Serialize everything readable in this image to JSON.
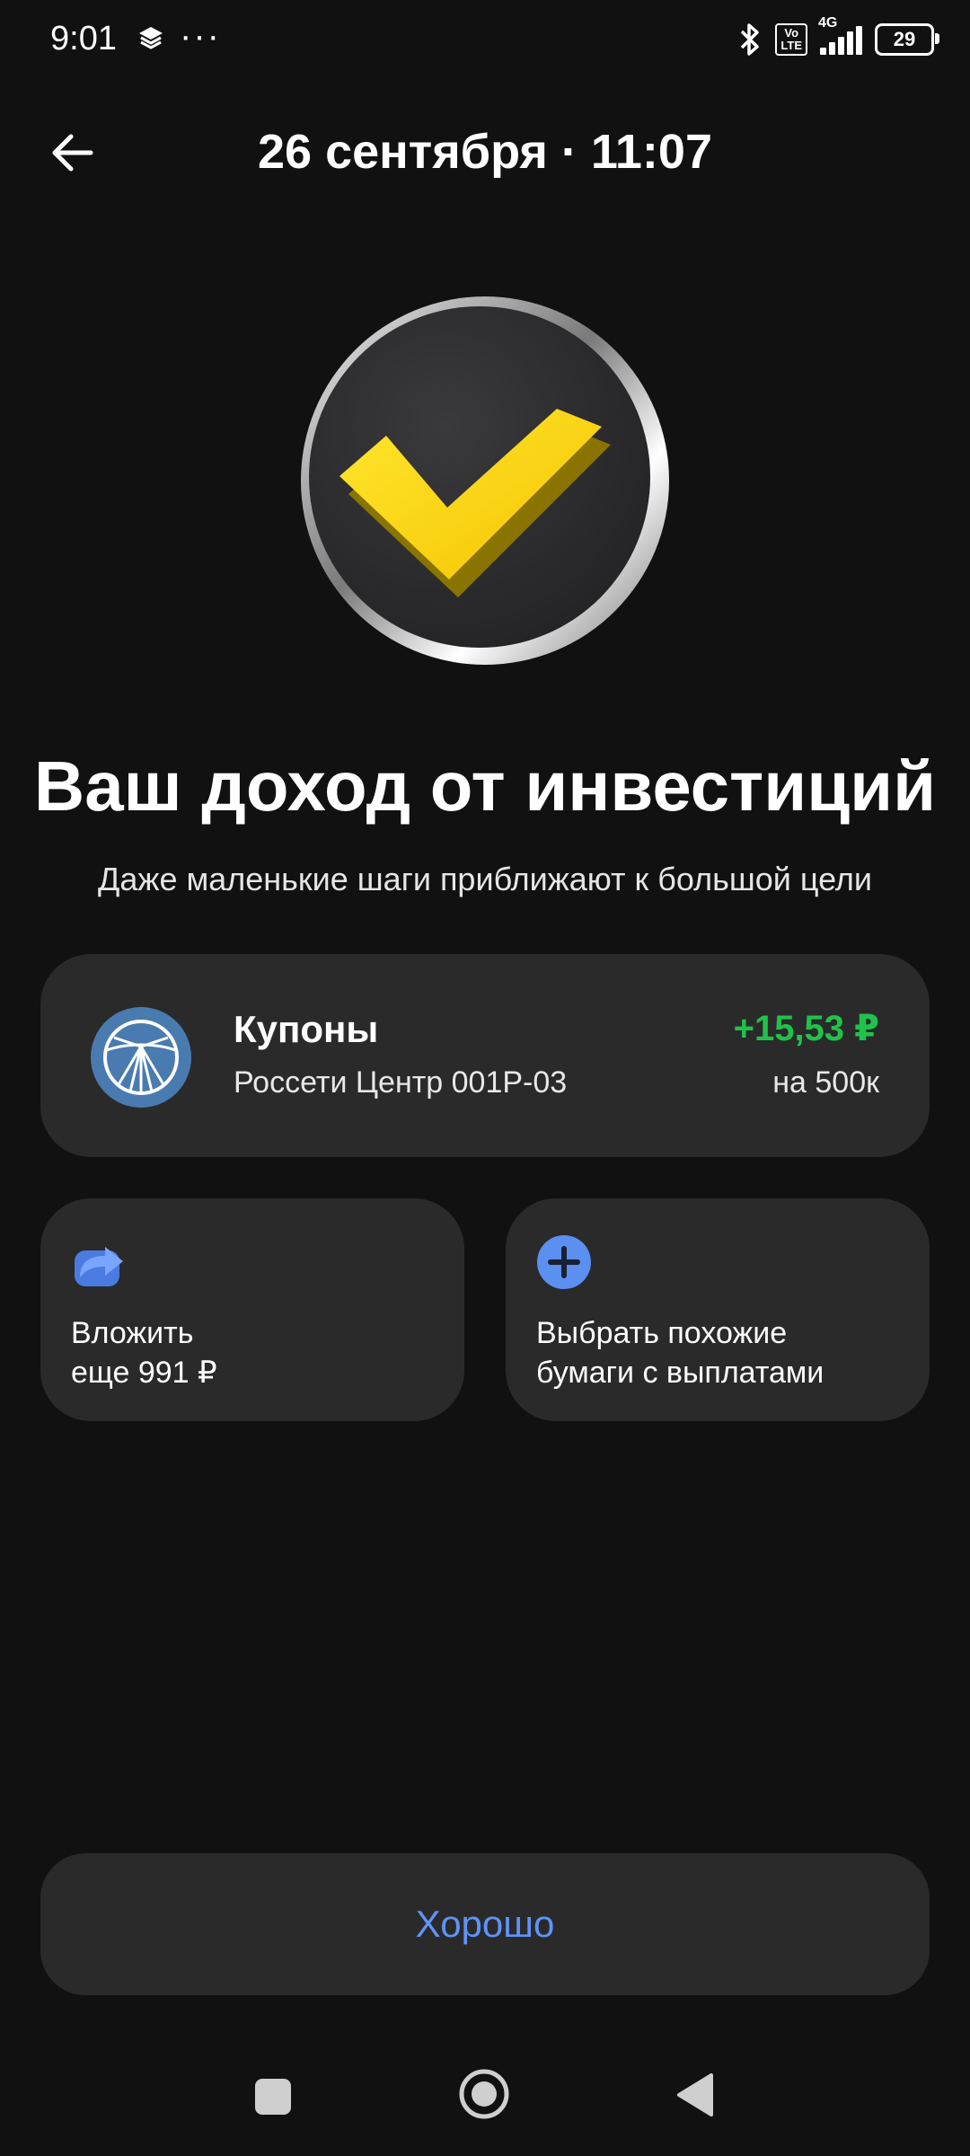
{
  "status_bar": {
    "time": "9:01",
    "dots": "···",
    "network": "4G",
    "volte": "Vo\nLTE",
    "battery": "29",
    "icons": [
      "layers-icon",
      "bluetooth-icon",
      "volte-icon",
      "signal-icon",
      "battery-icon"
    ]
  },
  "header": {
    "back_icon": "arrow-left-icon",
    "title": "26 сентября · 11:07"
  },
  "hero": {
    "icon": "yellow-checkmark-coin",
    "title": "Ваш доход от инвестиций",
    "subtitle": "Даже маленькие шаги приближают к большой цели"
  },
  "coupon": {
    "logo_icon": "rosseti-logo-icon",
    "title": "Купоны",
    "security": "Россети Центр 001P-03",
    "amount": "+15,53 ₽",
    "quantity": "на 500к",
    "amount_color": "#21c24a"
  },
  "actions": [
    {
      "icon": "share-arrow-icon",
      "line1": "Вложить",
      "line2": "еще 991 ₽"
    },
    {
      "icon": "plus-circle-icon",
      "line1": "Выбрать похожие",
      "line2": "бумаги с выплатами"
    }
  ],
  "primary_button": {
    "label": "Хорошо",
    "color": "#5f93f5"
  },
  "nav": {
    "icons": [
      "recents-square-icon",
      "home-circle-icon",
      "back-triangle-icon"
    ]
  }
}
